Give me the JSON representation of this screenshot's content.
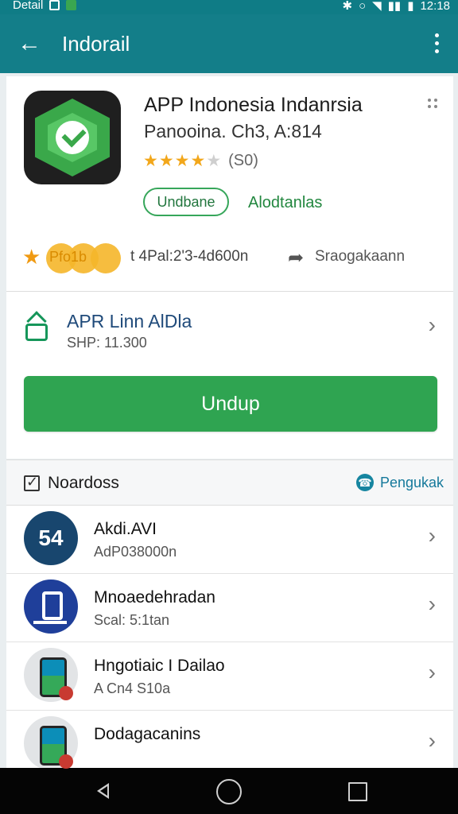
{
  "status_bar": {
    "left_label": "Detail",
    "time": "12:18"
  },
  "app_bar": {
    "title": "Indorail",
    "back_icon": "arrow-left-icon",
    "menu_icon": "more-vert-icon"
  },
  "app": {
    "icon": "shield-check-app-icon",
    "title": "APP Indonesia Indanrsia",
    "subtitle": "Panooina. Ch3, A:814",
    "rating_stars": 4.5,
    "rating_count": "(S0)",
    "status_pill": "Undbane",
    "secondary_action": "Alodtanlas"
  },
  "meta": {
    "badge_text": "Pfo1b",
    "info": "t 4Pal:2'3-4d600n",
    "share_label": "Sraogakaann"
  },
  "package": {
    "title": "APR Linn AlDla",
    "subtitle": "SHP: 11.300",
    "download_label": "Undup"
  },
  "section": {
    "title": "Noardoss",
    "action_label": "Pengukak"
  },
  "list": {
    "items": [
      {
        "avatar_text": "54",
        "title": "Akdi.AVI",
        "subtitle": "AdP038000n"
      },
      {
        "avatar_text": "",
        "title": "Mnoaedehradan",
        "subtitle": "Scal: 5:1tan"
      },
      {
        "avatar_text": "",
        "title": "Hngotiaic I Dailao",
        "subtitle": "A Cn4 S10a"
      },
      {
        "avatar_text": "",
        "title": "Dodagacanins",
        "subtitle": ""
      }
    ]
  },
  "colors": {
    "appbar": "#137e89",
    "primary_green": "#2fa451",
    "accent_blue": "#15799b"
  }
}
